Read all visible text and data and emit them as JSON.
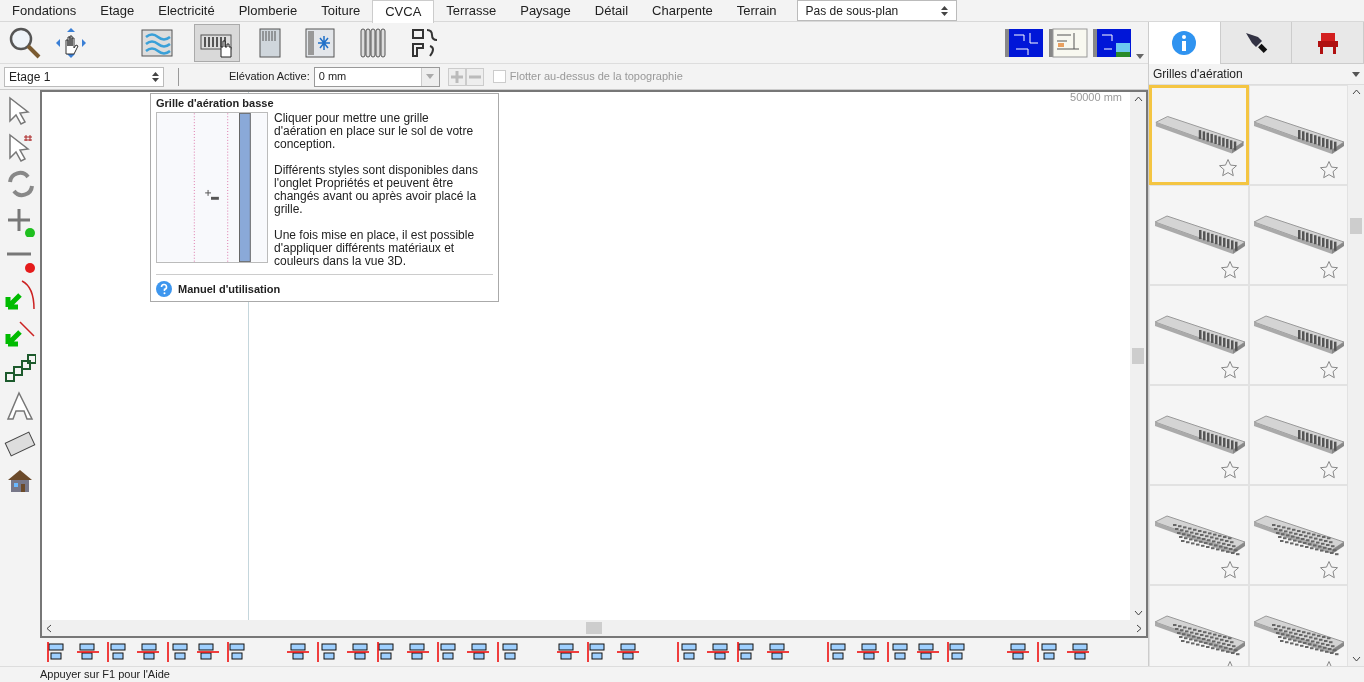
{
  "tabs": [
    {
      "label": "Fondations",
      "selected": false
    },
    {
      "label": "Etage",
      "selected": false
    },
    {
      "label": "Electricité",
      "selected": false
    },
    {
      "label": "Plomberie",
      "selected": false
    },
    {
      "label": "Toiture",
      "selected": false
    },
    {
      "label": "CVCA",
      "selected": true
    },
    {
      "label": "Terrasse",
      "selected": false
    },
    {
      "label": "Paysage",
      "selected": false
    },
    {
      "label": "Détail",
      "selected": false
    },
    {
      "label": "Charpente",
      "selected": false
    },
    {
      "label": "Terrain",
      "selected": false
    }
  ],
  "plan_select": {
    "value": "Pas de sous-plan"
  },
  "toolbar": {
    "tools": [
      {
        "kind": "zoom",
        "selected": false
      },
      {
        "kind": "pan",
        "selected": false
      },
      {
        "kind": "vent-wall",
        "selected": false
      },
      {
        "kind": "vent-floor",
        "selected": true
      },
      {
        "kind": "grille",
        "selected": false
      },
      {
        "kind": "ac",
        "selected": false
      },
      {
        "kind": "radiator",
        "selected": false
      },
      {
        "kind": "duct",
        "selected": false
      }
    ]
  },
  "options_bar": {
    "floor_select": "Etage 1",
    "elevation_label": "Elévation Active:",
    "elevation_value": "0 mm",
    "float_checkbox": {
      "label": "Flotter au-dessus de la topographie",
      "checked": false,
      "disabled": true
    }
  },
  "canvas": {
    "ruler_text": "50000 mm"
  },
  "tooltip": {
    "title": "Grille d'aération basse",
    "paragraphs": [
      "Cliquer pour mettre une grille d'aération en place sur le sol de votre conception.",
      "Différents styles sont disponibles dans l'onglet Propriétés et peuvent être changés avant ou après avoir placé la grille.",
      "Une fois mise en place, il est possible d'appliquer différents matériaux et couleurs dans la vue 3D."
    ],
    "link": "Manuel d'utilisation"
  },
  "status_bar": "Appuyer sur F1 pour l'Aide",
  "library": {
    "panel_tabs": [
      {
        "kind": "info",
        "selected": true
      },
      {
        "kind": "pen",
        "selected": false
      },
      {
        "kind": "chair",
        "selected": false
      }
    ],
    "category": "Grilles d'aération",
    "items": [
      {
        "kind": "plain",
        "selected": true,
        "favorite": false
      },
      {
        "kind": "plain",
        "selected": false,
        "favorite": false
      },
      {
        "kind": "plain",
        "selected": false,
        "favorite": false
      },
      {
        "kind": "plain",
        "selected": false,
        "favorite": false
      },
      {
        "kind": "plain",
        "selected": false,
        "favorite": false
      },
      {
        "kind": "plain",
        "selected": false,
        "favorite": false
      },
      {
        "kind": "plain",
        "selected": false,
        "favorite": false
      },
      {
        "kind": "plain",
        "selected": false,
        "favorite": false
      },
      {
        "kind": "pattern",
        "selected": false,
        "favorite": false
      },
      {
        "kind": "pattern",
        "selected": false,
        "favorite": false
      },
      {
        "kind": "pattern",
        "selected": false,
        "favorite": false
      },
      {
        "kind": "pattern",
        "selected": false,
        "favorite": false
      }
    ]
  }
}
